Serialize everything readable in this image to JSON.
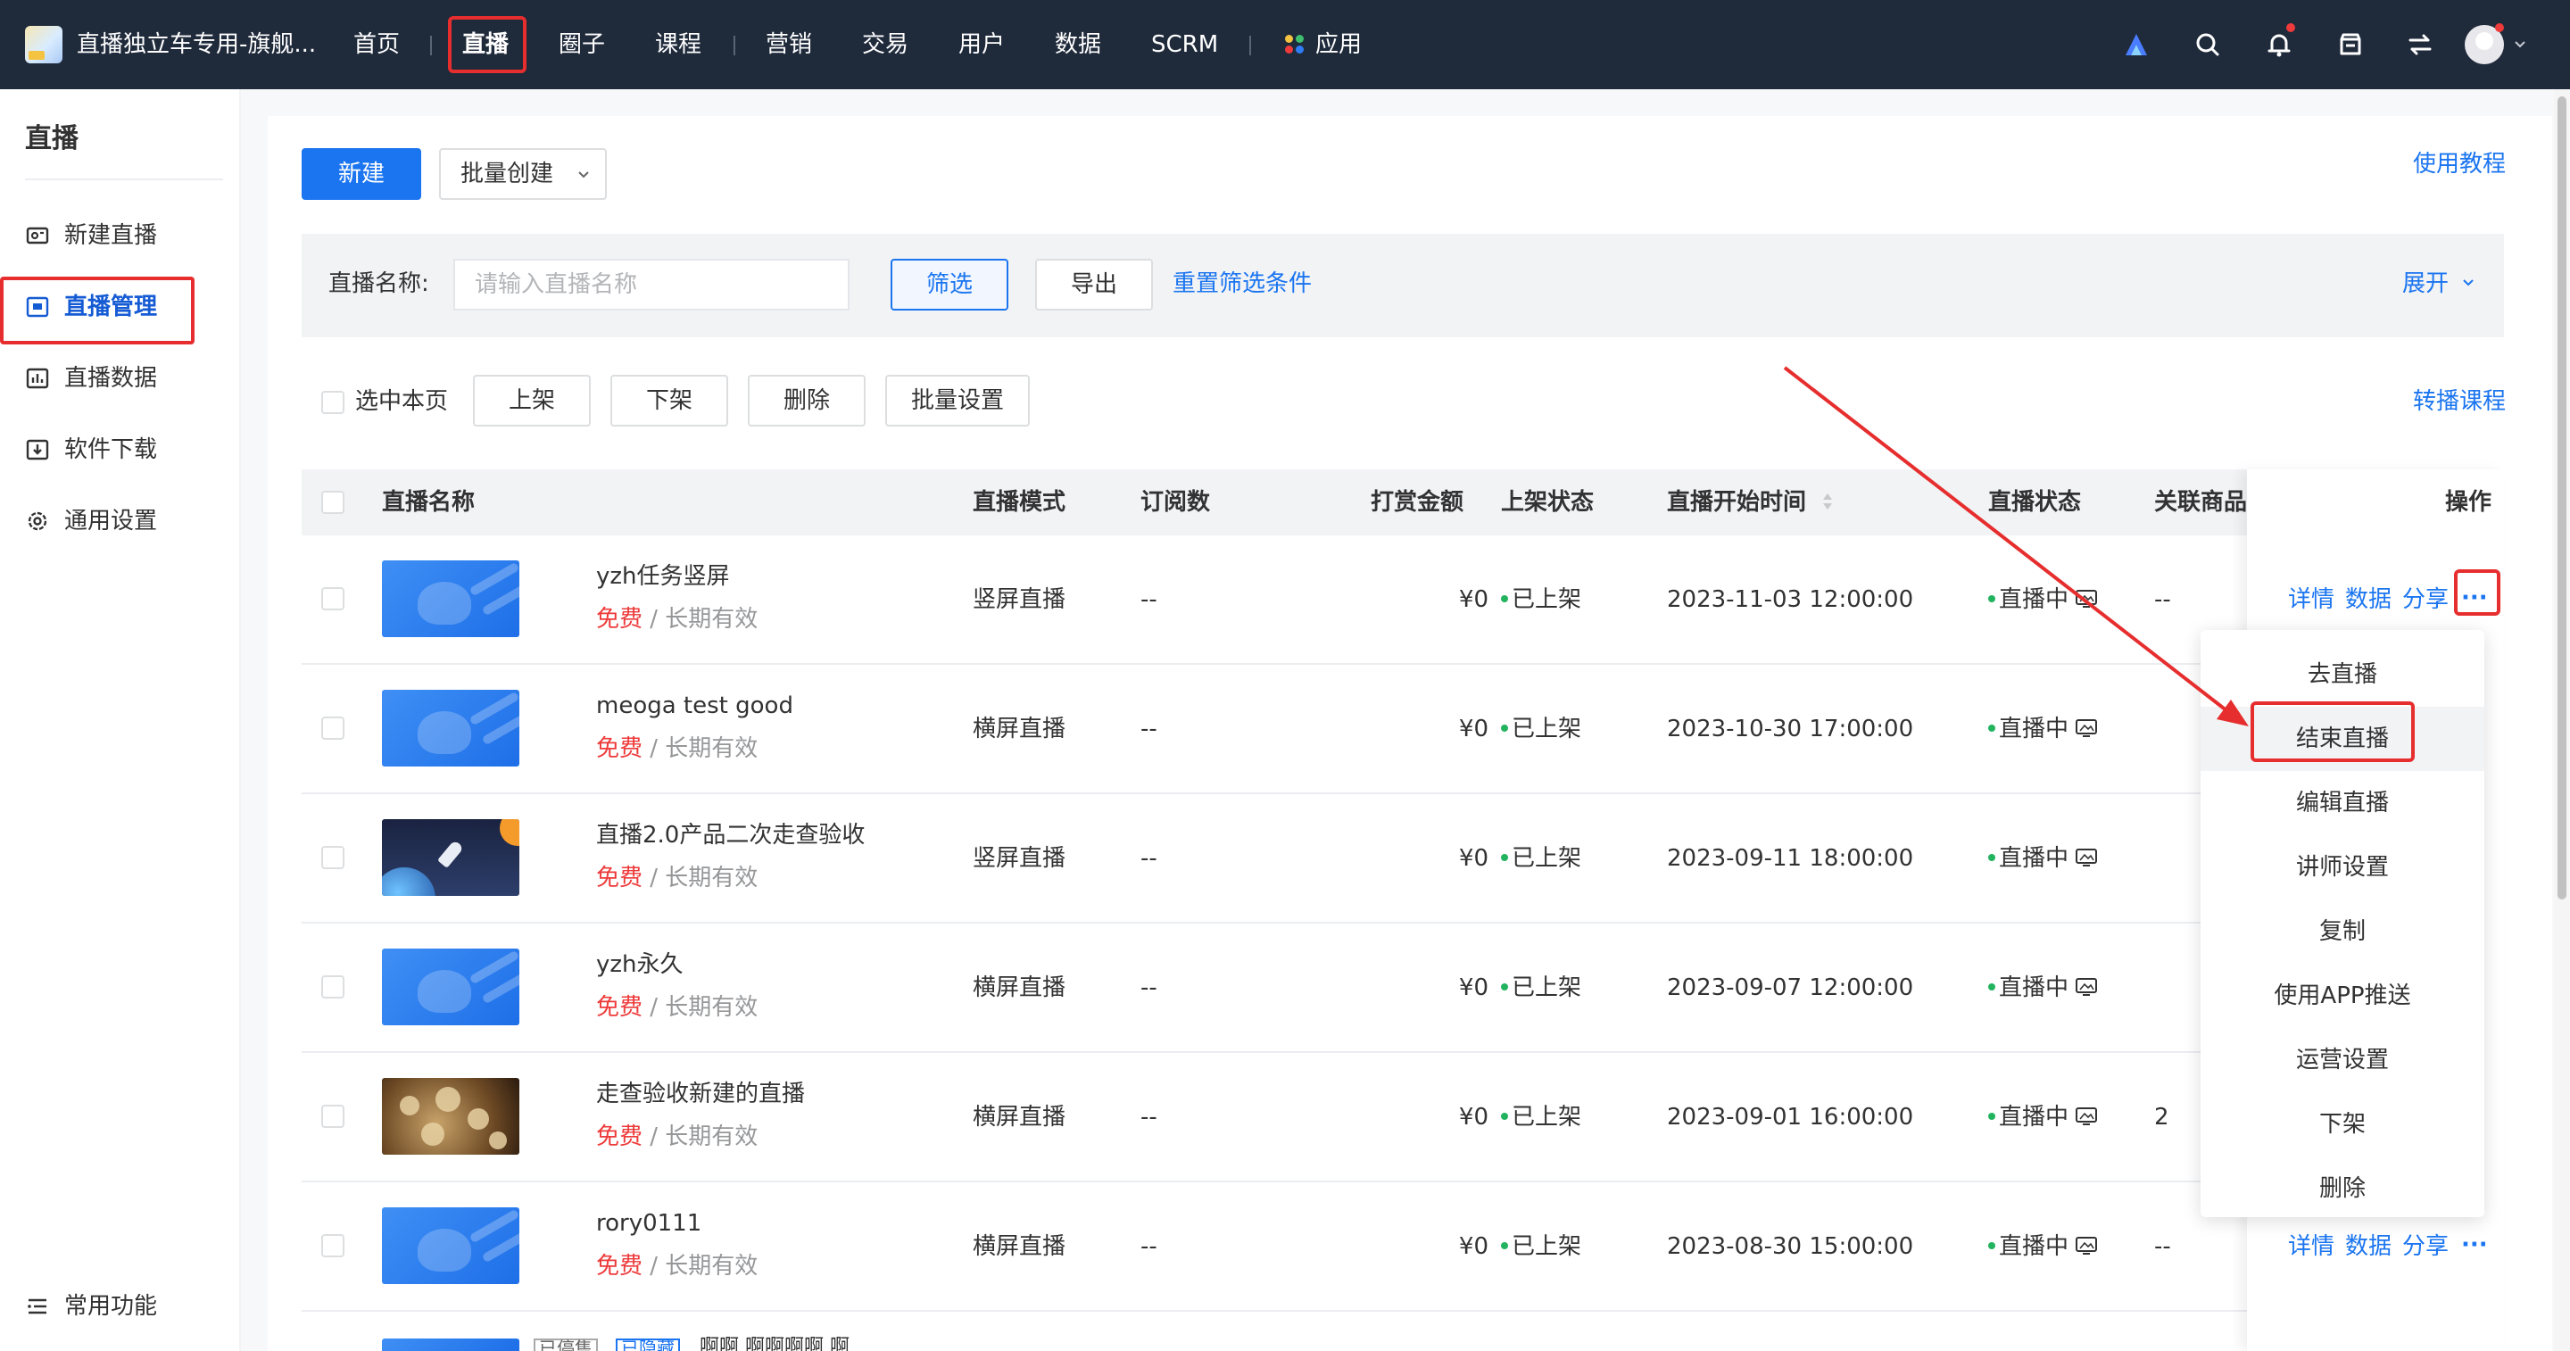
{
  "topnav": {
    "brand_title": "直播独立车专用-旗舰...",
    "items": [
      "首页",
      "直播",
      "圈子",
      "课程",
      "营销",
      "交易",
      "用户",
      "数据",
      "SCRM",
      "应用"
    ]
  },
  "sidebar": {
    "title": "直播",
    "items": [
      "新建直播",
      "直播管理",
      "直播数据",
      "软件下载",
      "通用设置"
    ],
    "bottom_item": "常用功能"
  },
  "toolbar": {
    "new_label": "新建",
    "batch_create_label": "批量创建",
    "tutorial_link": "使用教程"
  },
  "filter": {
    "label": "直播名称:",
    "placeholder": "请输入直播名称",
    "filter_button": "筛选",
    "export_button": "导出",
    "reset_link": "重置筛选条件",
    "expand_link": "展开"
  },
  "bulk": {
    "select_page": "选中本页",
    "on_shelf": "上架",
    "off_shelf": "下架",
    "delete": "删除",
    "batch_settings": "批量设置",
    "relay_course": "转播课程"
  },
  "table": {
    "headers": [
      "直播名称",
      "直播模式",
      "订阅数",
      "打赏金额",
      "上架状态",
      "直播开始时间",
      "直播状态",
      "关联商品",
      "操作"
    ],
    "rows": [
      {
        "name": "yzh任务竖屏",
        "free": "免费",
        "validity": "/ 长期有效",
        "mode": "竖屏直播",
        "subs": "--",
        "amount": "¥0",
        "shelf": "已上架",
        "start": "2023-11-03 12:00:00",
        "status": "直播中",
        "goods": "--"
      },
      {
        "name": "meoga test good",
        "free": "免费",
        "validity": "/ 长期有效",
        "mode": "横屏直播",
        "subs": "--",
        "amount": "¥0",
        "shelf": "已上架",
        "start": "2023-10-30 17:00:00",
        "status": "直播中",
        "goods": ""
      },
      {
        "name": "直播2.0产品二次走查验收",
        "free": "免费",
        "validity": "/ 长期有效",
        "mode": "竖屏直播",
        "subs": "--",
        "amount": "¥0",
        "shelf": "已上架",
        "start": "2023-09-11 18:00:00",
        "status": "直播中",
        "goods": ""
      },
      {
        "name": "yzh永久",
        "free": "免费",
        "validity": "/ 长期有效",
        "mode": "横屏直播",
        "subs": "--",
        "amount": "¥0",
        "shelf": "已上架",
        "start": "2023-09-07 12:00:00",
        "status": "直播中",
        "goods": ""
      },
      {
        "name": "走查验收新建的直播",
        "free": "免费",
        "validity": "/ 长期有效",
        "mode": "横屏直播",
        "subs": "--",
        "amount": "¥0",
        "shelf": "已上架",
        "start": "2023-09-01 16:00:00",
        "status": "直播中",
        "goods": "2"
      },
      {
        "name": "rory0111",
        "free": "免费",
        "validity": "/ 长期有效",
        "mode": "横屏直播",
        "subs": "--",
        "amount": "¥0",
        "shelf": "已上架",
        "start": "2023-08-30 15:00:00",
        "status": "直播中",
        "goods": "--"
      }
    ],
    "actions": {
      "detail": "详情",
      "data": "数据",
      "share": "分享",
      "more": "···"
    }
  },
  "dropdown": {
    "items": [
      "去直播",
      "结束直播",
      "编辑直播",
      "讲师设置",
      "复制",
      "使用APP推送",
      "运营设置",
      "下架",
      "删除"
    ]
  },
  "partial_row": {
    "tags": [
      "已停售",
      "已隐藏"
    ],
    "text": "啊啊 啊啊啊啊 啊"
  },
  "colors": {
    "nav_bg": "#1f2a3b",
    "primary": "#1b75f0",
    "highlight": "#e62e2e",
    "free_text": "#ee3a3a",
    "status_dot": "#22b35e"
  }
}
